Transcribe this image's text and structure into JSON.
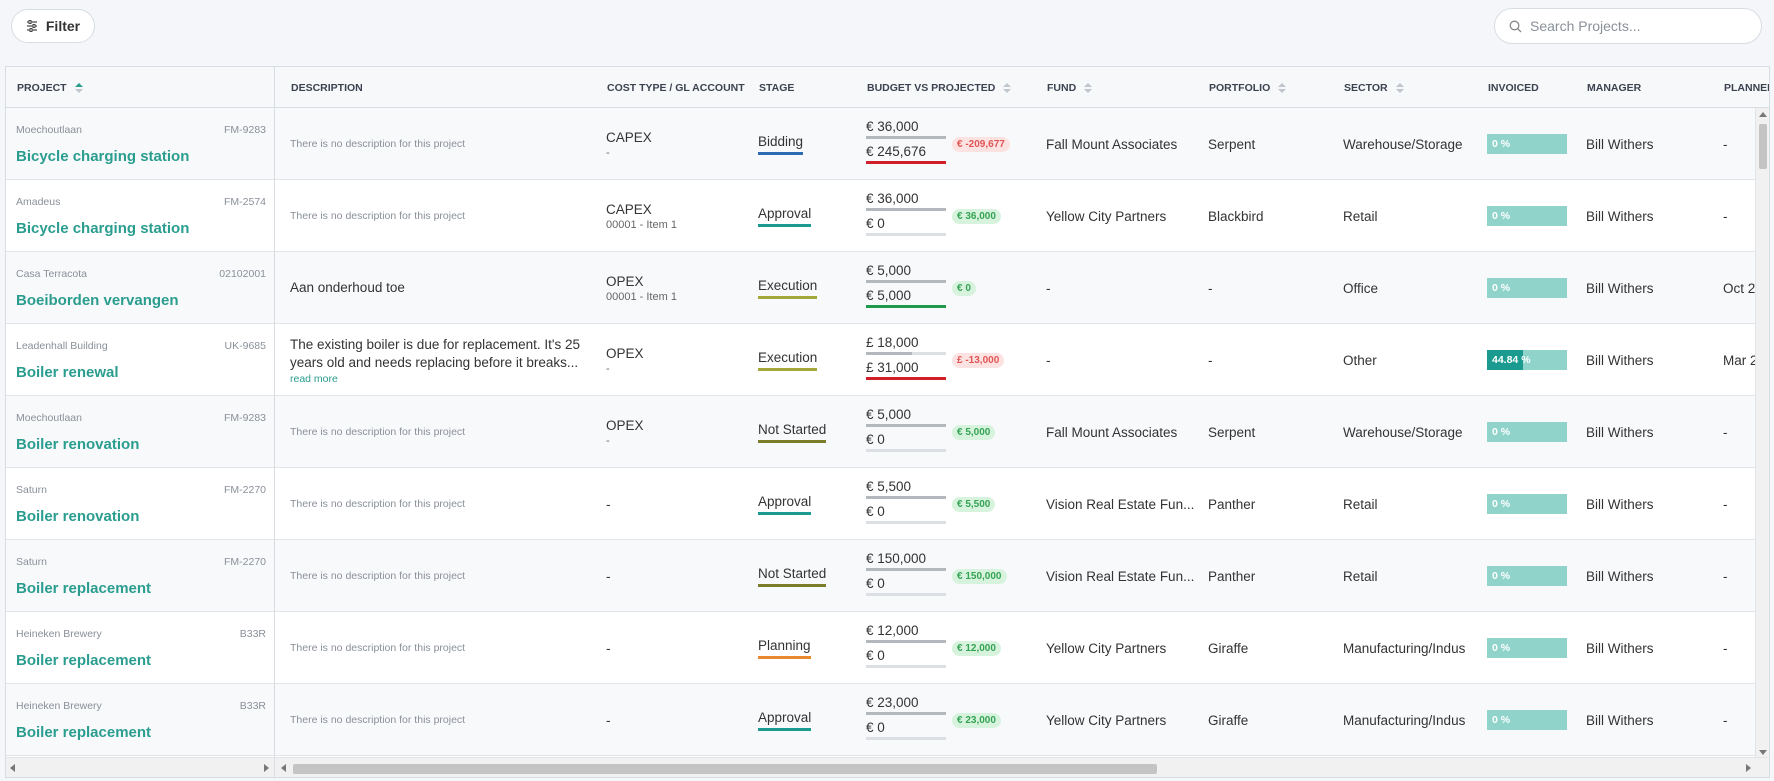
{
  "toolbar": {
    "filter_label": "Filter",
    "search_placeholder": "Search Projects..."
  },
  "columns": {
    "project": "PROJECT",
    "description": "DESCRIPTION",
    "cost_type": "COST TYPE / GL ACCOUNT",
    "stage": "STAGE",
    "budget": "BUDGET VS PROJECTED",
    "fund": "FUND",
    "portfolio": "PORTFOLIO",
    "sector": "SECTOR",
    "invoiced": "INVOICED",
    "manager": "MANAGER",
    "planned": "PLANNED S"
  },
  "colors": {
    "accent": "#2a9d8f",
    "stage_bidding": "#2e6ab3",
    "stage_approval": "#1b9b8f",
    "stage_execution": "#a3a83a",
    "stage_not_started": "#7a7d2a",
    "stage_planning": "#e8892f",
    "over_budget": "#d11f2a",
    "on_budget": "#1f9a4a"
  },
  "rows": [
    {
      "site": "Moechoutlaan",
      "code": "FM-9283",
      "name": "Bicycle charging station",
      "description": "There is no description for this project",
      "desc_full": false,
      "cost_type": "CAPEX",
      "gl": "-",
      "stage": "Bidding",
      "stage_color": "#2e6ab3",
      "budget": "€ 36,000",
      "projected": "€ 245,676",
      "diff": "€ -209,677",
      "diff_negative": true,
      "budget_fill": 1,
      "projected_fill": 1,
      "projected_color": "#d11f2a",
      "fund": "Fall Mount Associates",
      "portfolio": "Serpent",
      "sector": "Warehouse/Storage",
      "invoiced": "0 %",
      "invoiced_fraction": 0,
      "manager": "Bill Withers",
      "planned": "-"
    },
    {
      "site": "Amadeus",
      "code": "FM-2574",
      "name": "Bicycle charging station",
      "description": "There is no description for this project",
      "desc_full": false,
      "cost_type": "CAPEX",
      "gl": "00001 - Item 1",
      "stage": "Approval",
      "stage_color": "#1b9b8f",
      "budget": "€ 36,000",
      "projected": "€ 0",
      "diff": "€ 36,000",
      "diff_negative": false,
      "budget_fill": 1,
      "projected_fill": 0,
      "projected_color": "#1f9a4a",
      "fund": "Yellow City Partners",
      "portfolio": "Blackbird",
      "sector": "Retail",
      "invoiced": "0 %",
      "invoiced_fraction": 0,
      "manager": "Bill Withers",
      "planned": "-"
    },
    {
      "site": "Casa Terracota",
      "code": "02102001",
      "name": "Boeiborden vervangen",
      "description": "Aan onderhoud toe",
      "desc_full": true,
      "cost_type": "OPEX",
      "gl": "00001 - Item 1",
      "stage": "Execution",
      "stage_color": "#a3a83a",
      "budget": "€ 5,000",
      "projected": "€ 5,000",
      "diff": "€ 0",
      "diff_negative": false,
      "budget_fill": 1,
      "projected_fill": 1,
      "projected_color": "#1f9a4a",
      "fund": "-",
      "portfolio": "-",
      "sector": "Office",
      "invoiced": "0 %",
      "invoiced_fraction": 0,
      "manager": "Bill Withers",
      "planned": "Oct 2"
    },
    {
      "site": "Leadenhall Building",
      "code": "UK-9685",
      "name": "Boiler renewal",
      "description": "The existing boiler is due for replacement. It's 25 years old and needs replacing before it breaks...",
      "desc_full": true,
      "read_more": "read more",
      "cost_type": "OPEX",
      "gl": "-",
      "stage": "Execution",
      "stage_color": "#a3a83a",
      "budget": "£ 18,000",
      "projected": "£ 31,000",
      "diff": "£ -13,000",
      "diff_negative": true,
      "budget_fill": 0.58,
      "projected_fill": 1,
      "projected_color": "#d11f2a",
      "fund": "-",
      "portfolio": "-",
      "sector": "Other",
      "invoiced": "44.84 %",
      "invoiced_fraction": 0.4484,
      "manager": "Bill Withers",
      "planned": "Mar 2"
    },
    {
      "site": "Moechoutlaan",
      "code": "FM-9283",
      "name": "Boiler renovation",
      "description": "There is no description for this project",
      "desc_full": false,
      "cost_type": "OPEX",
      "gl": "-",
      "stage": "Not Started",
      "stage_color": "#7a7d2a",
      "budget": "€ 5,000",
      "projected": "€ 0",
      "diff": "€ 5,000",
      "diff_negative": false,
      "budget_fill": 1,
      "projected_fill": 0,
      "projected_color": "#1f9a4a",
      "fund": "Fall Mount Associates",
      "portfolio": "Serpent",
      "sector": "Warehouse/Storage",
      "invoiced": "0 %",
      "invoiced_fraction": 0,
      "manager": "Bill Withers",
      "planned": "-"
    },
    {
      "site": "Saturn",
      "code": "FM-2270",
      "name": "Boiler renovation",
      "description": "There is no description for this project",
      "desc_full": false,
      "cost_type": "-",
      "gl": "",
      "stage": "Approval",
      "stage_color": "#1b9b8f",
      "budget": "€ 5,500",
      "projected": "€ 0",
      "diff": "€ 5,500",
      "diff_negative": false,
      "budget_fill": 1,
      "projected_fill": 0,
      "projected_color": "#1f9a4a",
      "fund": "Vision Real Estate Fun...",
      "portfolio": "Panther",
      "sector": "Retail",
      "invoiced": "0 %",
      "invoiced_fraction": 0,
      "manager": "Bill Withers",
      "planned": "-"
    },
    {
      "site": "Saturn",
      "code": "FM-2270",
      "name": "Boiler replacement",
      "description": "There is no description for this project",
      "desc_full": false,
      "cost_type": "-",
      "gl": "",
      "stage": "Not Started",
      "stage_color": "#7a7d2a",
      "budget": "€ 150,000",
      "projected": "€ 0",
      "diff": "€ 150,000",
      "diff_negative": false,
      "budget_fill": 1,
      "projected_fill": 0,
      "projected_color": "#1f9a4a",
      "fund": "Vision Real Estate Fun...",
      "portfolio": "Panther",
      "sector": "Retail",
      "invoiced": "0 %",
      "invoiced_fraction": 0,
      "manager": "Bill Withers",
      "planned": "-"
    },
    {
      "site": "Heineken Brewery",
      "code": "B33R",
      "name": "Boiler replacement",
      "description": "There is no description for this project",
      "desc_full": false,
      "cost_type": "-",
      "gl": "",
      "stage": "Planning",
      "stage_color": "#e8892f",
      "budget": "€ 12,000",
      "projected": "€ 0",
      "diff": "€ 12,000",
      "diff_negative": false,
      "budget_fill": 1,
      "projected_fill": 0,
      "projected_color": "#1f9a4a",
      "fund": "Yellow City Partners",
      "portfolio": "Giraffe",
      "sector": "Manufacturing/Indus",
      "invoiced": "0 %",
      "invoiced_fraction": 0,
      "manager": "Bill Withers",
      "planned": "-"
    },
    {
      "site": "Heineken Brewery",
      "code": "B33R",
      "name": "Boiler replacement",
      "description": "There is no description for this project",
      "desc_full": false,
      "cost_type": "-",
      "gl": "",
      "stage": "Approval",
      "stage_color": "#1b9b8f",
      "budget": "€ 23,000",
      "projected": "€ 0",
      "diff": "€ 23,000",
      "diff_negative": false,
      "budget_fill": 1,
      "projected_fill": 0,
      "projected_color": "#1f9a4a",
      "fund": "Yellow City Partners",
      "portfolio": "Giraffe",
      "sector": "Manufacturing/Indus",
      "invoiced": "0 %",
      "invoiced_fraction": 0,
      "manager": "Bill Withers",
      "planned": "-"
    }
  ]
}
